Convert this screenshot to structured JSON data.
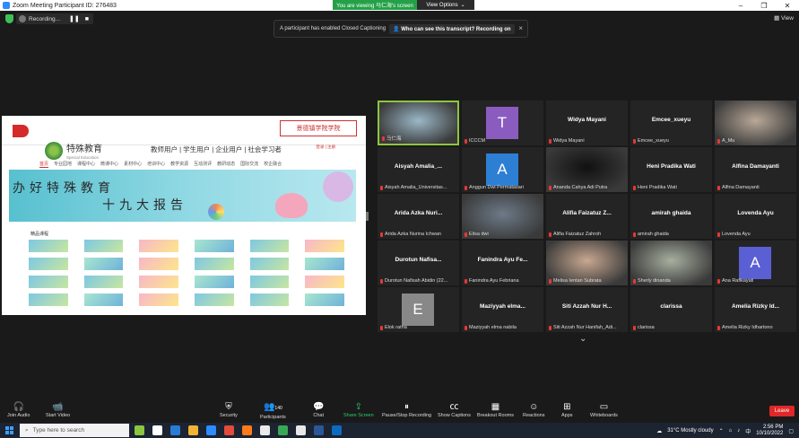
{
  "window": {
    "title": "Zoom Meeting Participant ID: 276483",
    "viewing_banner": "You are viewing 马仁海's screen",
    "view_options": "View Options",
    "controls": [
      "–",
      "❐",
      "✕"
    ]
  },
  "topbar": {
    "recording": "Recording...",
    "pause": "❚❚",
    "stop": "■",
    "view": "View"
  },
  "cc_banner": {
    "message": "A participant has enabled Closed Captioning",
    "link": "Who can see this transcript? Recording on",
    "close": "×"
  },
  "shared": {
    "brand": "特殊教育",
    "brand_sub": "Special Education",
    "seal_text": "景德镇学院学院",
    "users": "教师用户 | 学生用户 | 企业用户 | 社会学习者",
    "reglinks": "登录 | 注册",
    "menu": [
      "首页",
      "专业园地",
      "课程中心",
      "微课中心",
      "素材中心",
      "培训中心",
      "教学资源",
      "互动测评",
      "教研动态",
      "国际交流",
      "校企融合"
    ],
    "banner_line1": "办好特殊教育",
    "banner_line2": "十九大报告",
    "course_heading": "精品课程"
  },
  "participants": [
    {
      "display": "video",
      "label": "马仁海",
      "tone": "#9bb8c8",
      "active": true
    },
    {
      "display": "avatar",
      "initial": "T",
      "color": "#8a5cc0",
      "label": "ICCCM"
    },
    {
      "display": "name",
      "name": "Widya Mayani",
      "label": "Widya Mayani"
    },
    {
      "display": "name",
      "name": "Emcee_xueyu",
      "label": "Emcee_xueyu"
    },
    {
      "display": "video",
      "label": "A_Mu",
      "tone": "#b8a898"
    },
    {
      "display": "name",
      "name": "Aisyah Amalia_...",
      "label": "Aisyah Amalia_Universitas..."
    },
    {
      "display": "avatar",
      "initial": "A",
      "color": "#2d7fd4",
      "label": "Anggun Dwi Permatasari"
    },
    {
      "display": "video",
      "label": "Ananda Cahya Adi Putra",
      "tone": "#111111"
    },
    {
      "display": "name",
      "name": "Heni Pradika Wati",
      "label": "Heni Pradika Wati"
    },
    {
      "display": "name",
      "name": "Alfina Damayanti",
      "label": "Alfina Damayanti"
    },
    {
      "display": "name",
      "name": "Arida Azka Nuri...",
      "label": "Arida Azka Nurina Ichwan"
    },
    {
      "display": "video",
      "label": "Elisa dwi",
      "tone": "#6d7a88"
    },
    {
      "display": "name",
      "name": "Alifia Faizatuz Z...",
      "label": "Alifia Faizatuz Zahroh"
    },
    {
      "display": "name",
      "name": "amirah ghaida",
      "label": "amirah ghaida"
    },
    {
      "display": "name",
      "name": "Lovenda Ayu",
      "label": "Lovenda Ayu"
    },
    {
      "display": "name",
      "name": "Durotun Nafisa...",
      "label": "Durotun Nafisah Abidin (22..."
    },
    {
      "display": "name",
      "name": "Fanindra Ayu Fe...",
      "label": "Fanindra Ayu Febriana"
    },
    {
      "display": "video",
      "label": "Melisa Ientan Subrata",
      "tone": "#c9a890"
    },
    {
      "display": "video",
      "label": "Sherly dinanda",
      "tone": "#a8b0a0"
    },
    {
      "display": "avatar",
      "initial": "A",
      "color": "#5a5fd4",
      "label": "Ana Rafikayati"
    },
    {
      "display": "avatar",
      "initial": "E",
      "color": "#888888",
      "label": "Elok ratna"
    },
    {
      "display": "name",
      "name": "Maziyyah elma...",
      "label": "Maziyyah elma nabila"
    },
    {
      "display": "name",
      "name": "Siti Azzah Nur H...",
      "label": "Siti Azzah Nur Hanifah_Adi..."
    },
    {
      "display": "name",
      "name": "clarissa",
      "label": "clarissa"
    },
    {
      "display": "name",
      "name": "Amelia Rizky Id...",
      "label": "Amelia Rizky Idhartono"
    }
  ],
  "toolbar": {
    "join_audio": "Join Audio",
    "start_video": "Start Video",
    "security": "Security",
    "participants": "Participants",
    "participants_count": "140",
    "chat": "Chat",
    "share_screen": "Share Screen",
    "recording": "Pause/Stop Recording",
    "captions": "Show Captions",
    "breakout": "Breakout Rooms",
    "reactions": "Reactions",
    "apps": "Apps",
    "whiteboards": "Whiteboards",
    "leave": "Leave"
  },
  "taskbar": {
    "search_placeholder": "Type here to search",
    "weather": "31°C  Mostly cloudy",
    "ime": "中",
    "time": "2:56 PM",
    "date": "10/10/2022"
  },
  "colors": {
    "accent_green": "#24a148",
    "leave_red": "#e02828",
    "active_border": "#8cc63f",
    "zoom_blue": "#2d8cff"
  }
}
